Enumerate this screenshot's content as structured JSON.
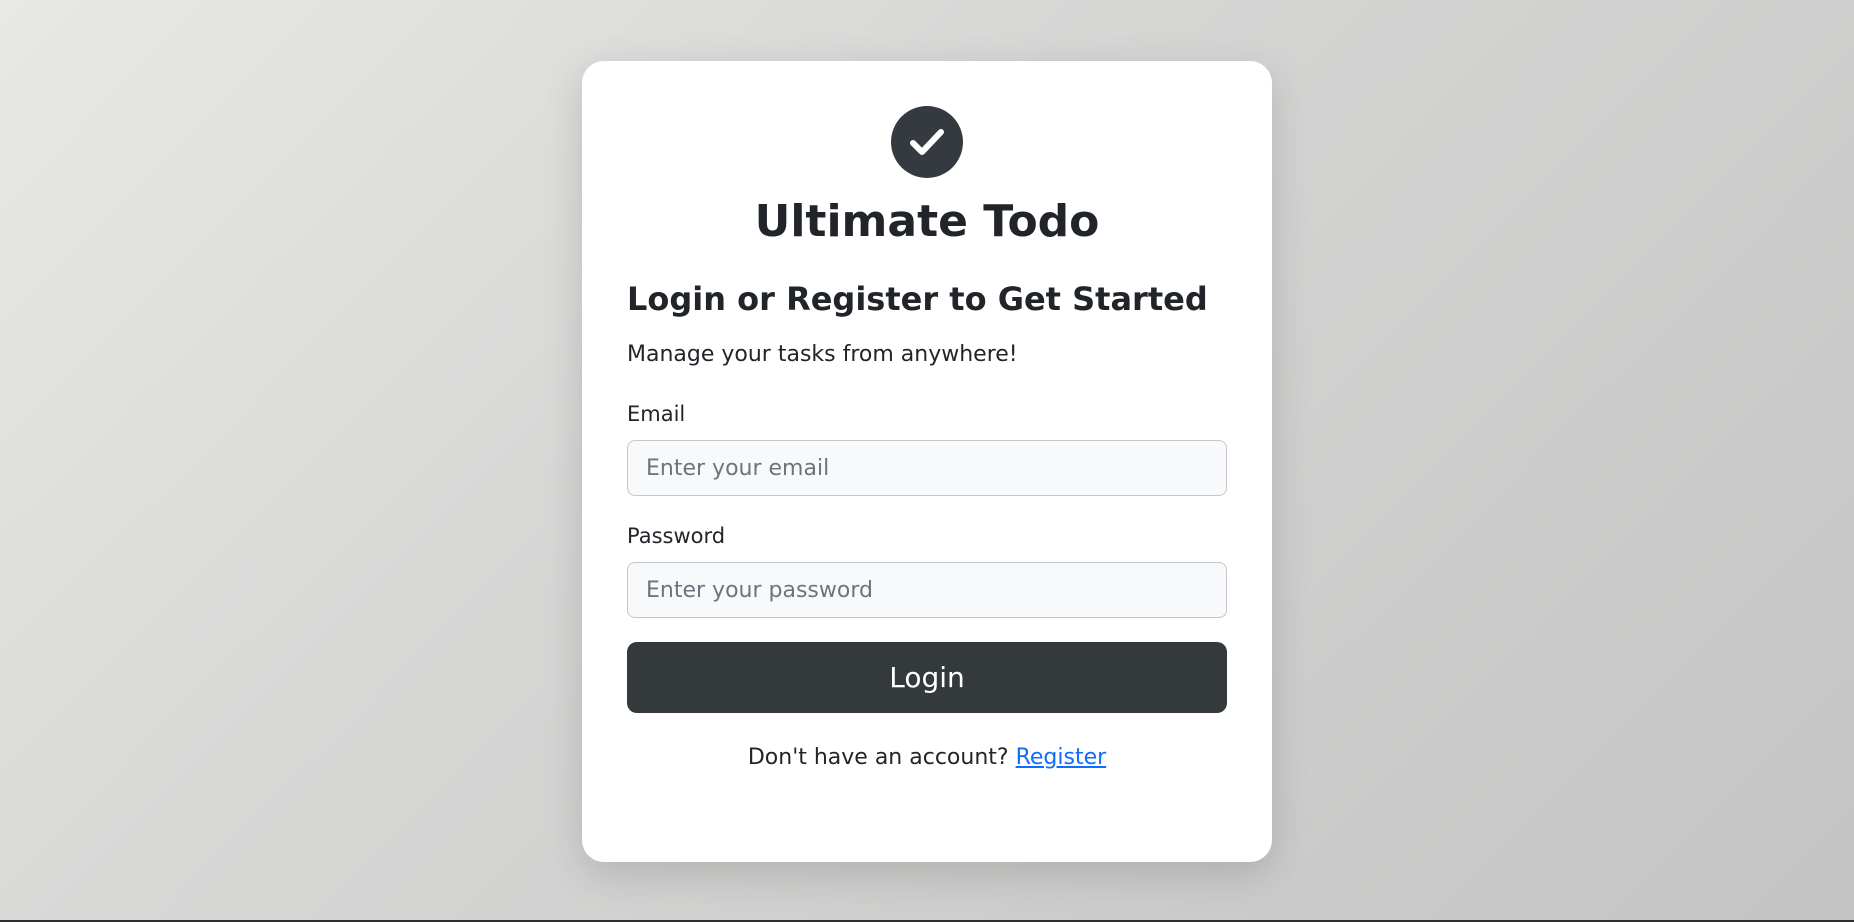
{
  "app": {
    "title": "Ultimate Todo",
    "logo_icon": "check-circle-icon"
  },
  "login": {
    "heading": "Login or Register to Get Started",
    "subtext": "Manage your tasks from anywhere!",
    "email": {
      "label": "Email",
      "placeholder": "Enter your email",
      "value": ""
    },
    "password": {
      "label": "Password",
      "placeholder": "Enter your password",
      "value": ""
    },
    "submit_label": "Login",
    "footer_prompt": "Don't have an account?",
    "register_label": "Register"
  },
  "colors": {
    "primary_dark": "#343a40",
    "link": "#0d6efd",
    "card_bg": "#ffffff"
  }
}
